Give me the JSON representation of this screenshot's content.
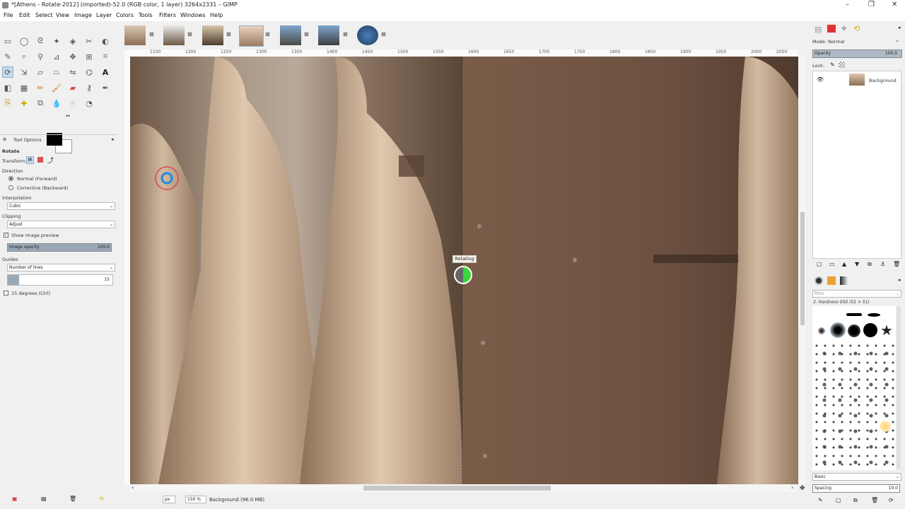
{
  "window": {
    "title": "*[Athens - Rotate-2012] (imported)-52.0 (RGB color, 1 layer) 3264x2331 – GIMP",
    "minimize": "–",
    "maximize": "❐",
    "close": "✕"
  },
  "menu": [
    "File",
    "Edit",
    "Select",
    "View",
    "Image",
    "Layer",
    "Colors",
    "Tools",
    "Filters",
    "Windows",
    "Help"
  ],
  "toolbox": {
    "tools": [
      "rect-select",
      "ellipse-select",
      "free-select",
      "fuzzy-select",
      "color-select",
      "scissors",
      "foreground-select",
      "paths",
      "color-picker",
      "zoom",
      "measure",
      "move",
      "align",
      "crop",
      "rotate",
      "scale",
      "shear",
      "perspective",
      "flip",
      "cage",
      "warp",
      "text",
      "bucket",
      "gradient",
      "pencil",
      "paintbrush",
      "eraser",
      "airbrush",
      "ink",
      "mybrush",
      "clone",
      "heal",
      "perspective-clone",
      "blur",
      "smudge",
      "dodge"
    ]
  },
  "tool_options": {
    "panel_title": "Tool Options",
    "tool_name": "Rotate",
    "transform_label": "Transform:",
    "direction_label": "Direction",
    "direction_options": [
      "Normal (Forward)",
      "Corrective (Backward)"
    ],
    "interpolation_label": "Interpolation",
    "interpolation_value": "Cubic",
    "clipping_label": "Clipping",
    "clipping_value": "Adjust",
    "show_preview_label": "Show image preview",
    "image_opacity_label": "Image opacity",
    "image_opacity_value": "100.0",
    "guides_label": "Guides",
    "guides_value": "Number of lines",
    "lines_value": "15",
    "degrees_label": "15 degrees  (Ctrl)"
  },
  "ruler_ticks": [
    "1150",
    "1200",
    "1250",
    "1300",
    "1350",
    "1400",
    "1450",
    "1500",
    "1550",
    "1600",
    "1650",
    "1700",
    "1750",
    "1800",
    "1850",
    "1900",
    "1950",
    "2000",
    "2050"
  ],
  "overlay": {
    "rotating_label": "Rotating"
  },
  "status": {
    "unit": "px",
    "zoom": "150 %",
    "info": "Background (96.0 MB)"
  },
  "layers": {
    "mode_label": "Mode: Normal",
    "opacity_label": "Opacity",
    "opacity_value": "100.0",
    "lock_label": "Lock:",
    "layer_name": "Background"
  },
  "brushes": {
    "filter_placeholder": "filter",
    "brush_name": "2. Hardness 050 (51 × 51)",
    "preset": "Basic",
    "spacing_label": "Spacing",
    "spacing_value": "10.0"
  },
  "colors": {
    "accent": "#8fb1d3",
    "canvas_dark": "#7a5f4c",
    "stone": "#c9ae93"
  }
}
